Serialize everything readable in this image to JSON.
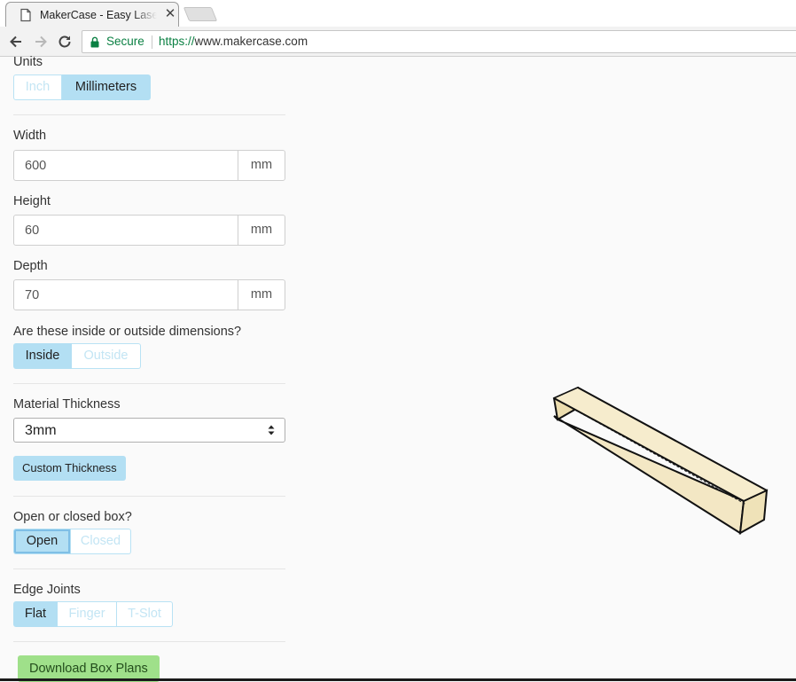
{
  "browser": {
    "tab_title": "MakerCase - Easy Laser Cut Case Design",
    "tab_close": "✕",
    "secure_label": "Secure",
    "url_scheme": "https://",
    "url_host": "www.makercase.com"
  },
  "form": {
    "units": {
      "label": "Units",
      "options": [
        "Inch",
        "Millimeters"
      ],
      "selected": "Millimeters"
    },
    "width": {
      "label": "Width",
      "value": "600",
      "unit": "mm"
    },
    "height": {
      "label": "Height",
      "value": "60",
      "unit": "mm"
    },
    "depth": {
      "label": "Depth",
      "value": "70",
      "unit": "mm"
    },
    "dimension_type": {
      "label": "Are these inside or outside dimensions?",
      "options": [
        "Inside",
        "Outside"
      ],
      "selected": "Inside"
    },
    "material": {
      "label": "Material Thickness",
      "selected": "3mm",
      "custom_button": "Custom Thickness"
    },
    "box_type": {
      "label": "Open or closed box?",
      "options": [
        "Open",
        "Closed"
      ],
      "selected": "Open"
    },
    "edge_joints": {
      "label": "Edge Joints",
      "options": [
        "Flat",
        "Finger",
        "T-Slot"
      ],
      "selected": "Flat"
    },
    "download_button": "Download Box Plans"
  },
  "colors": {
    "accent": "#b3dff3",
    "download": "#9fe08a",
    "secure": "#0b8043",
    "box_face": "#f3e7c4"
  }
}
